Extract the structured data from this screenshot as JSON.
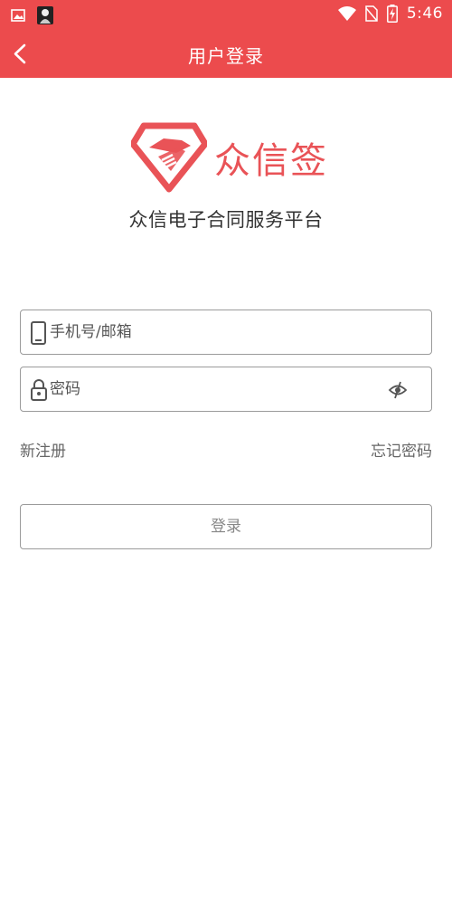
{
  "status_bar": {
    "time": "5:46",
    "battery_glyph": "⚡"
  },
  "app_bar": {
    "title": "用户登录"
  },
  "brand": {
    "name": "众信签",
    "subtitle": "众信电子合同服务平台",
    "color": "#e95357"
  },
  "form": {
    "account_placeholder": "手机号/邮箱",
    "password_placeholder": "密码"
  },
  "links": {
    "register": "新注册",
    "forgot_password": "忘记密码"
  },
  "login_button": {
    "label": "登录"
  },
  "colors": {
    "header": "#ec4b4d",
    "border": "#9b9b9b"
  }
}
